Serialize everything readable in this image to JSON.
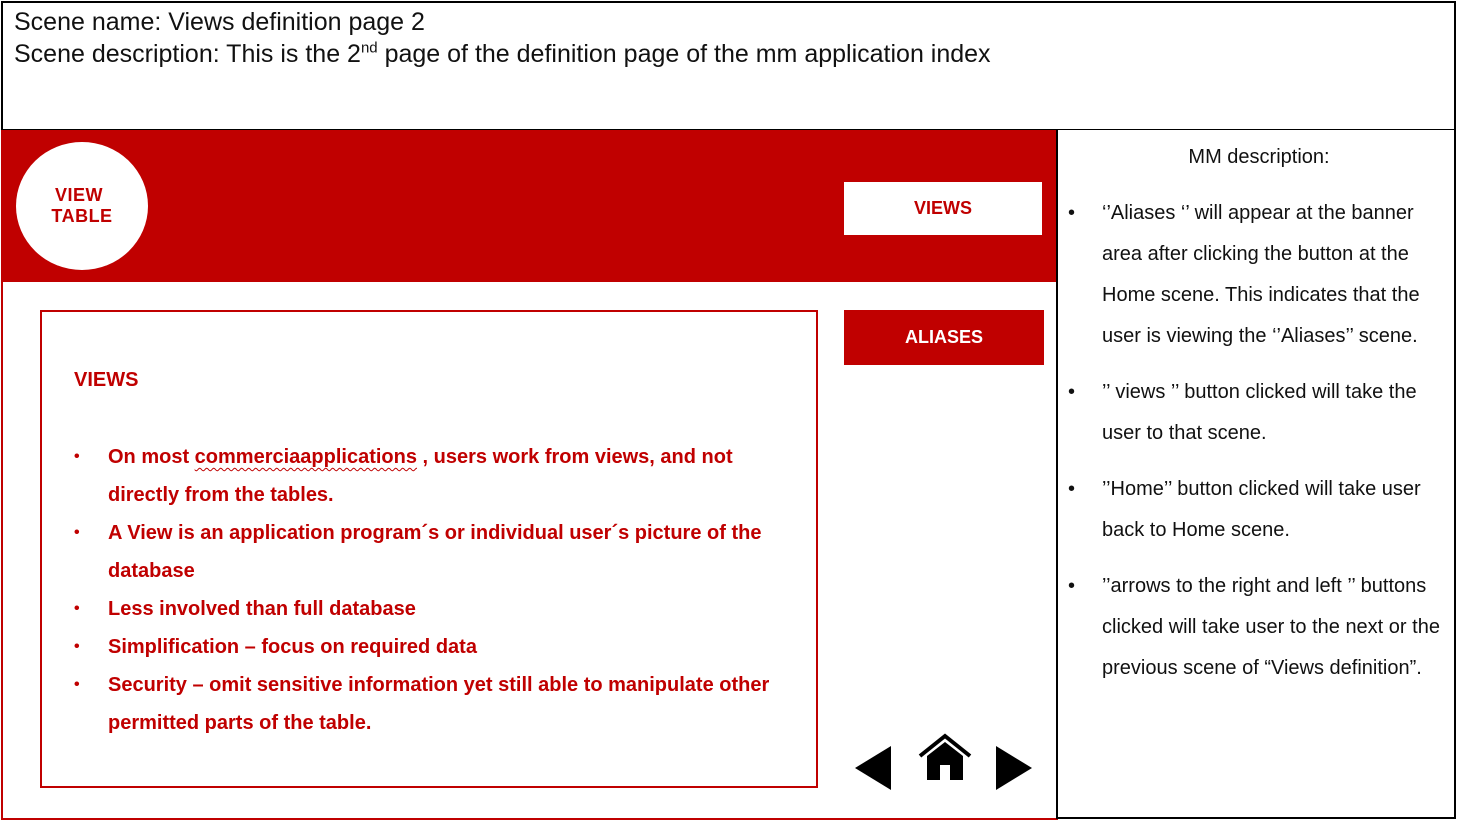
{
  "header": {
    "scene_name": "Scene name: Views definition page 2",
    "scene_desc_prefix": "Scene description: This is the 2",
    "scene_desc_sup": "nd",
    "scene_desc_suffix": " page of the definition page of the mm application index"
  },
  "logo": {
    "line1": "VIEW",
    "line2": "TABLE"
  },
  "buttons": {
    "views": "VIEWS",
    "aliases": "ALIASES"
  },
  "content": {
    "title": "VIEWS",
    "bullet1_part1": "On most ",
    "bullet1_misspelled": "commerciaapplications",
    "bullet1_part2": " , users work from views, and not directly from the tables.",
    "bullets": [
      "A View is an application program´s or individual user´s picture of the database",
      "Less involved than full database",
      "Simplification – focus on required data",
      "Security – omit sensitive information yet still able to manipulate other permitted parts of the table."
    ]
  },
  "navigation": {
    "left_icon": "arrow-left-icon",
    "home_icon": "home-icon",
    "right_icon": "arrow-right-icon"
  },
  "description": {
    "title": "MM description:",
    "items": [
      "‘’Aliases ‘’ will appear at the banner area after clicking the button at the Home scene. This indicates that the user is viewing the ‘’Aliases’’ scene.",
      "’’ views ’’ button clicked will take the user to that scene.",
      "’’Home’’ button clicked will take user back to Home scene.",
      "’’arrows to the right and left ’’ buttons clicked will take user to the next or the previous scene of “Views definition”."
    ]
  },
  "colors": {
    "accent": "#c00000",
    "text": "#111111",
    "background": "#ffffff"
  }
}
